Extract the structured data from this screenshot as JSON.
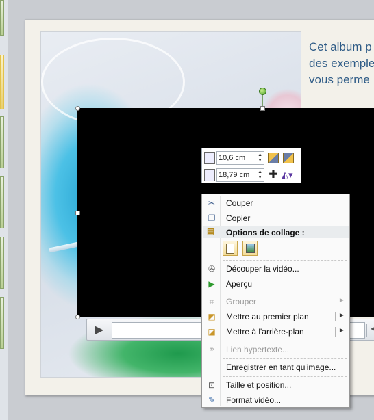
{
  "slide": {
    "text_lines": [
      "Cet album p",
      "des exemple",
      "vous perme"
    ]
  },
  "mini_toolbar": {
    "height_value": "10,6 cm",
    "width_value": "18,79 cm"
  },
  "context_menu": {
    "items": [
      {
        "label": "Couper",
        "icon": "scissors-icon",
        "enabled": true
      },
      {
        "label": "Copier",
        "icon": "copy-icon",
        "enabled": true
      },
      {
        "label": "Options de collage :",
        "icon": "paste-icon",
        "header": true
      },
      {
        "label": "Découper la vidéo...",
        "icon": "trim-video-icon",
        "enabled": true
      },
      {
        "label": "Aperçu",
        "icon": "play-icon",
        "enabled": true
      },
      {
        "label": "Grouper",
        "icon": "group-icon",
        "enabled": false,
        "submenu": true
      },
      {
        "label": "Mettre au premier plan",
        "icon": "bring-to-front-icon",
        "enabled": true,
        "submenu": true
      },
      {
        "label": "Mettre à l'arrière-plan",
        "icon": "send-to-back-icon",
        "enabled": true,
        "submenu": true
      },
      {
        "label": "Lien hypertexte...",
        "icon": "hyperlink-icon",
        "enabled": false
      },
      {
        "label": "Enregistrer en tant qu'image...",
        "icon": "",
        "enabled": true
      },
      {
        "label": "Taille et position...",
        "icon": "size-position-icon",
        "enabled": true
      },
      {
        "label": "Format vidéo...",
        "icon": "format-video-icon",
        "enabled": true
      }
    ]
  }
}
